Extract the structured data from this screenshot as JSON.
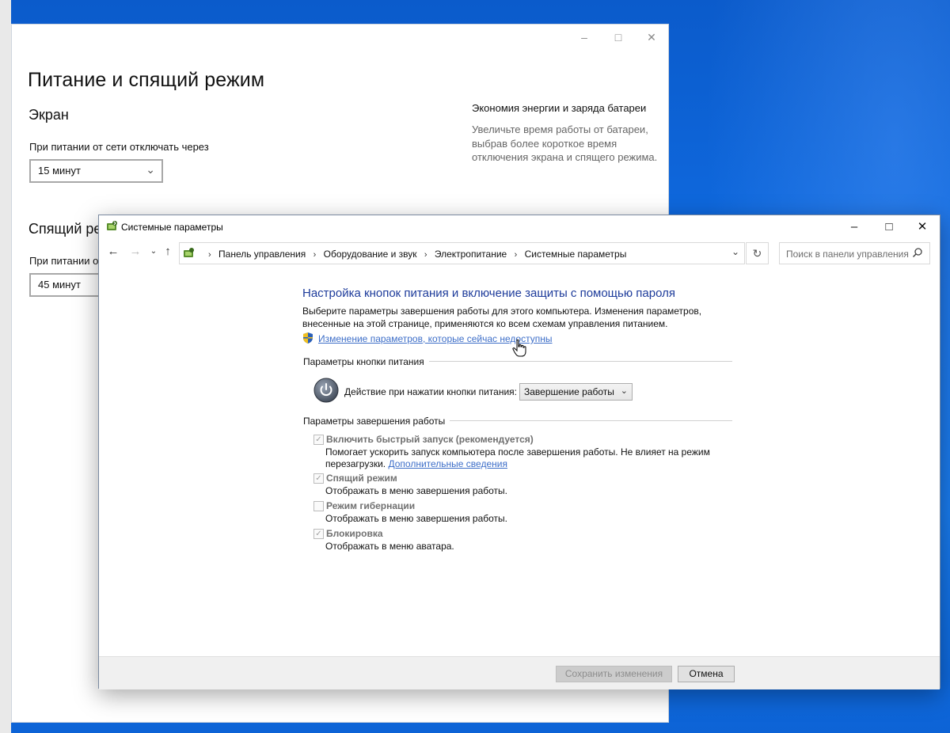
{
  "settings_window": {
    "title": "Питание и спящий режим",
    "screen_header": "Экран",
    "screen_label": "При питании от сети отключать через",
    "screen_value": "15 минут",
    "sleep_header": "Спящий ре",
    "sleep_label": "При питании о",
    "sleep_value": "45 минут",
    "aside_title": "Экономия энергии и заряда батареи",
    "aside_text": "Увеличьте время работы от батареи, выбрав более короткое время отключения экрана и спящего режима."
  },
  "control_panel": {
    "title": "Системные параметры",
    "breadcrumbs": [
      "Панель управления",
      "Оборудование и звук",
      "Электропитание",
      "Системные параметры"
    ],
    "search_placeholder": "Поиск в панели управления",
    "heading": "Настройка кнопок питания и включение защиты с помощью пароля",
    "description": "Выберите параметры завершения работы для этого компьютера. Изменения параметров, внесенные на этой странице, применяются ко всем схемам управления питанием.",
    "unlock_link": "Изменение параметров, которые сейчас недоступны",
    "power_button_section": "Параметры кнопки питания",
    "power_action_label": "Действие при нажатии кнопки питания:",
    "power_action_value": "Завершение работы",
    "shutdown_section": "Параметры завершения работы",
    "options": [
      {
        "title": "Включить быстрый запуск (рекомендуется)",
        "checked": true,
        "desc_line1": "Помогает ускорить запуск компьютера после завершения работы. Не влияет на режим",
        "desc_line2": "перезагрузки.",
        "link": "Дополнительные сведения"
      },
      {
        "title": "Спящий режим",
        "checked": true,
        "desc": "Отображать в меню завершения работы."
      },
      {
        "title": "Режим гибернации",
        "checked": false,
        "desc": "Отображать в меню завершения работы."
      },
      {
        "title": "Блокировка",
        "checked": true,
        "desc": "Отображать в меню аватара."
      }
    ],
    "save_button": "Сохранить изменения",
    "cancel_button": "Отмена"
  }
}
